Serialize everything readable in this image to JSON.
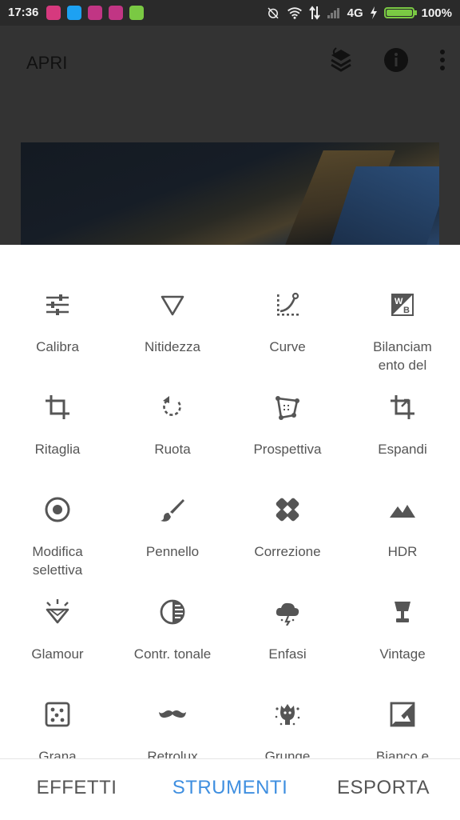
{
  "status_bar": {
    "time": "17:36",
    "network": "4G",
    "battery_percent": "100%",
    "battery_level": 1.0,
    "notification_icons": [
      {
        "name": "instagram-icon",
        "color": "#d6397e"
      },
      {
        "name": "twitter-icon",
        "color": "#1da1f2"
      },
      {
        "name": "instagram-icon",
        "color": "#c13584"
      },
      {
        "name": "instagram-icon",
        "color": "#c13584"
      },
      {
        "name": "android-icon",
        "color": "#7ac943"
      }
    ]
  },
  "app_bar": {
    "title": "APRI",
    "actions": [
      "layers-icon",
      "info-icon",
      "more-vert-icon"
    ]
  },
  "tools": [
    {
      "label": "Calibra",
      "icon": "tune-icon"
    },
    {
      "label": "Nitidezza",
      "icon": "details-icon"
    },
    {
      "label": "Curve",
      "icon": "curves-icon"
    },
    {
      "label": "Bilanciam ento del",
      "icon": "white-balance-icon"
    },
    {
      "label": "Ritaglia",
      "icon": "crop-icon"
    },
    {
      "label": "Ruota",
      "icon": "rotate-icon"
    },
    {
      "label": "Prospettiva",
      "icon": "perspective-icon"
    },
    {
      "label": "Espandi",
      "icon": "expand-icon"
    },
    {
      "label": "Modifica selettiva",
      "icon": "selective-icon"
    },
    {
      "label": "Pennello",
      "icon": "brush-icon"
    },
    {
      "label": "Correzione",
      "icon": "healing-icon"
    },
    {
      "label": "HDR",
      "icon": "hdr-landscape-icon"
    },
    {
      "label": "Glamour",
      "icon": "glamour-glow-icon"
    },
    {
      "label": "Contr. tonale",
      "icon": "tonal-contrast-icon"
    },
    {
      "label": "Enfasi",
      "icon": "drama-icon"
    },
    {
      "label": "Vintage",
      "icon": "vintage-lamp-icon"
    },
    {
      "label": "Grana",
      "icon": "grainy-film-icon"
    },
    {
      "label": "Retrolux",
      "icon": "retrolux-mustache-icon"
    },
    {
      "label": "Grunge",
      "icon": "grunge-icon"
    },
    {
      "label": "Bianco e",
      "icon": "black-white-icon"
    }
  ],
  "bottom_tabs": [
    {
      "label": "EFFETTI",
      "active": false
    },
    {
      "label": "STRUMENTI",
      "active": true
    },
    {
      "label": "ESPORTA",
      "active": false
    }
  ],
  "colors": {
    "accent": "#3f8fe0",
    "icon": "#555555",
    "scrim": "#333333"
  }
}
